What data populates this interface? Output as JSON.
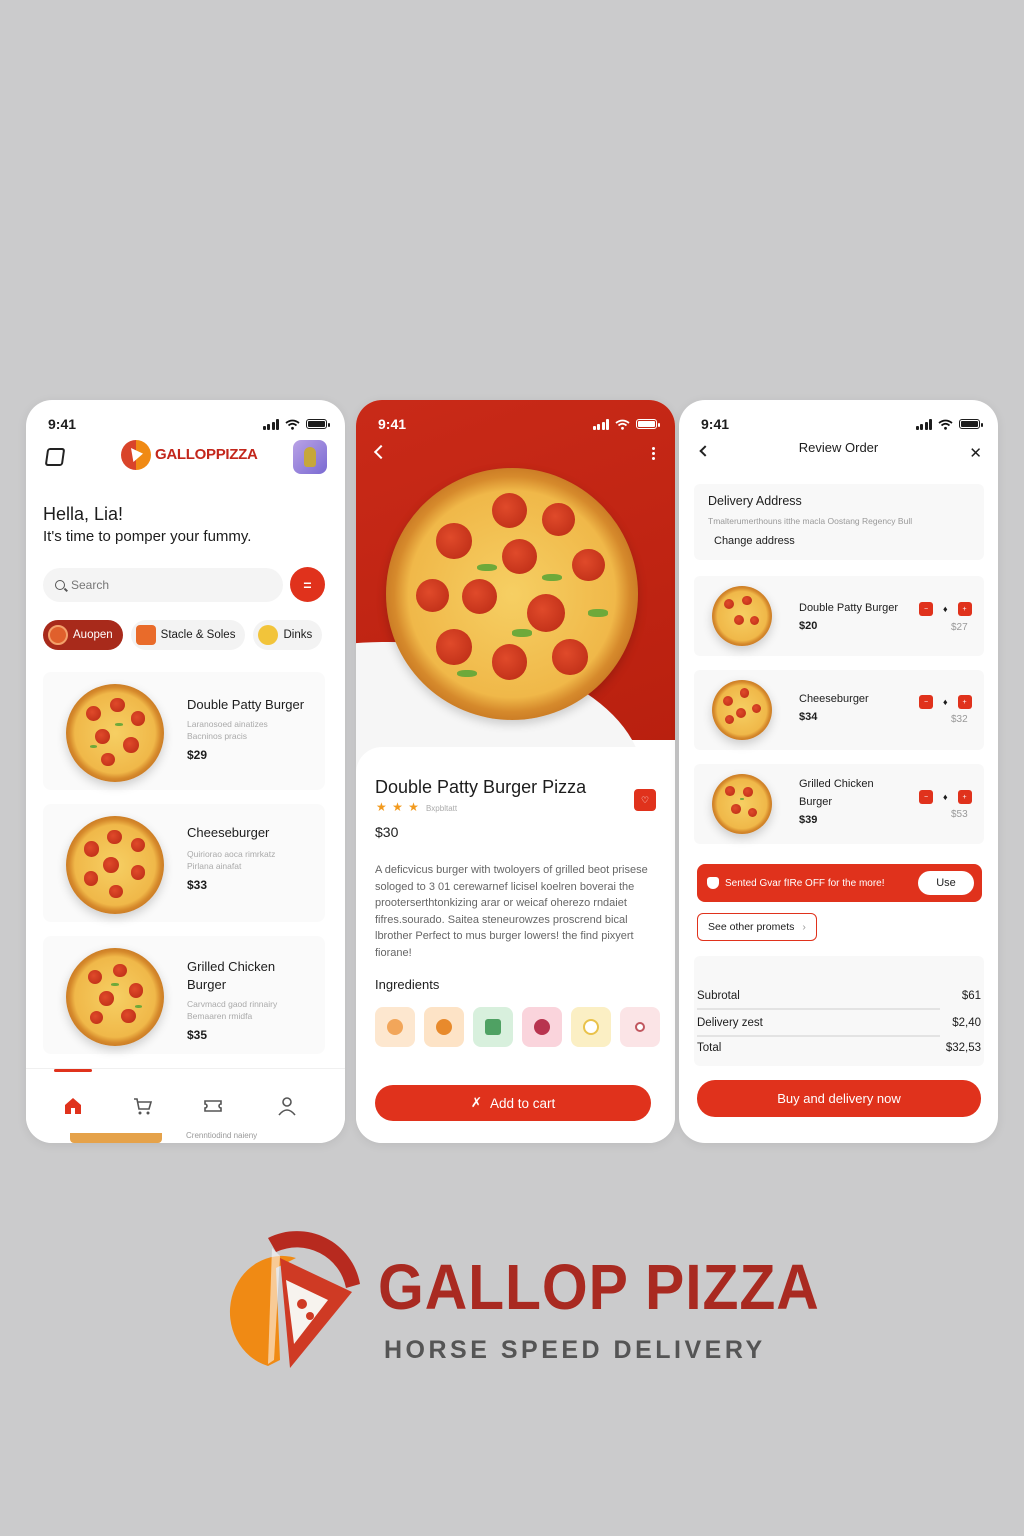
{
  "theme": {
    "accent": "#e0321c",
    "dark_accent": "#a82a1b",
    "orange": "#f08a14",
    "background": "#cbcbcc"
  },
  "home": {
    "time": "9:41",
    "logo_text": "GALLOPPIZZA",
    "greeting": "Hella, Lia!",
    "tagline": "It's time to pomper your fummy.",
    "search_placeholder": "Search",
    "chips": [
      {
        "label": "Auopen",
        "active": true
      },
      {
        "label": "Stacle & Soles",
        "active": false
      },
      {
        "label": "Dinks",
        "active": false
      }
    ],
    "items": [
      {
        "name": "Double Patty Burger",
        "desc": "Laranosoed ainatizes\nBacninos pracis",
        "price": "$29"
      },
      {
        "name": "Cheeseburger",
        "desc": "Quiriorao aoca rimrkatz\nPirlana ainafat",
        "price": "$33"
      },
      {
        "name": "Grilled Chicken Burger",
        "desc": "Carvmacd gaod rinnairy\nBemaaren rmidfa",
        "price": "$35"
      }
    ],
    "peek_text": "Crenntiodind naieny",
    "tabs": [
      "home-icon",
      "cart-icon",
      "ticket-icon",
      "profile-icon"
    ]
  },
  "detail": {
    "time": "9:41",
    "title": "Double Patty Burger Pizza",
    "stars": "★ ★ ★",
    "rating_note": "Bxpbltatt",
    "price": "$30",
    "description": "A deficvicus burger with twoloyers of grilled beot prisese sologed to 3 01 cerewarnef licisel koelren boverai the prooterserthtonkizing arar or weicaf oherezo rndaiet fifres.sourado. Saitea steneurowzes proscrend bical lbrother Perfect to mus burger lowers! the find pixyert fiorane!",
    "ingredients_title": "Ingredients",
    "ingredients": [
      {
        "bg": "#fde7cf",
        "dot": "#f2a65a"
      },
      {
        "bg": "#fde3c6",
        "dot": "#e88a2c"
      },
      {
        "bg": "#d8f0dd",
        "dot": "#4fa163"
      },
      {
        "bg": "#fad4dc",
        "dot": "#b8344f"
      },
      {
        "bg": "#fbefc4",
        "dot": "#e9c24a"
      },
      {
        "bg": "#fbe4e6",
        "dot": "#c1575f"
      }
    ],
    "cart_label": "Add to cart"
  },
  "review": {
    "time": "9:41",
    "title": "Review Order",
    "address_heading": "Delivery Address",
    "address_line": "Tmalterumerthouns itthe macla Oostang Regency Bull",
    "change_address": "Change address",
    "items": [
      {
        "name": "Double Patty Burger",
        "price": "$20",
        "old": "$27"
      },
      {
        "name": "Cheeseburger",
        "price": "$34",
        "old": "$32"
      },
      {
        "name": "Grilled Chicken Burger",
        "price": "$39",
        "old": "$53"
      }
    ],
    "promo_text": "Sented Gvar fIRe OFF for the more!",
    "use_label": "Use",
    "other_promos": "See other promets",
    "subtotal_label": "Subrotal",
    "subtotal": "$61",
    "delivery_label": "Delivery zest",
    "delivery": "$2,40",
    "total_label": "Total",
    "total": "$32,53",
    "buy_label": "Buy and delivery now"
  },
  "brand": {
    "name": "GALLOP PIZZA",
    "slogan": "HORSE SPEED DELIVERY"
  }
}
